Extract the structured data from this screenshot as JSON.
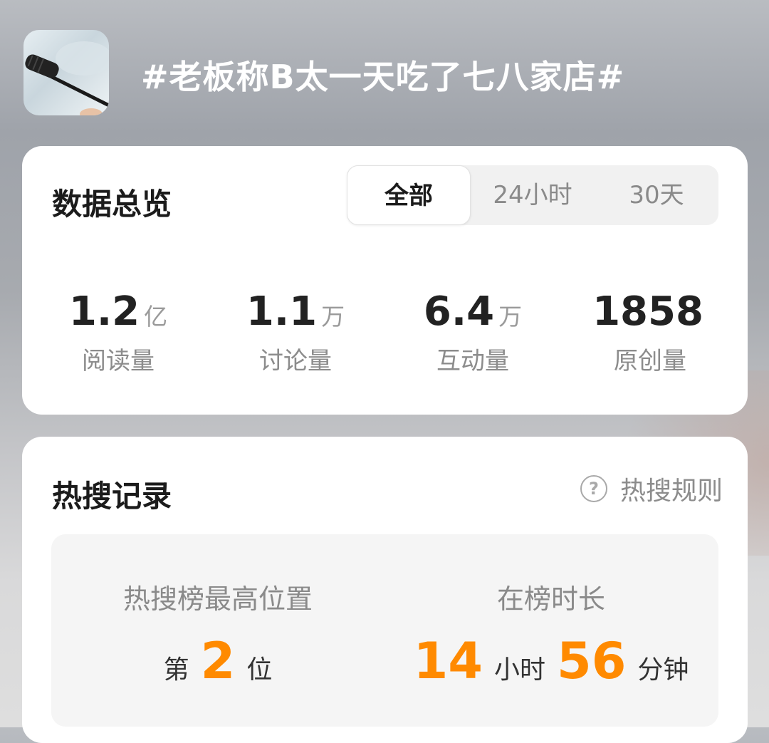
{
  "topic": {
    "title": "#老板称B太一天吃了七八家店#"
  },
  "overview": {
    "title": "数据总览",
    "tabs": [
      {
        "label": "全部",
        "active": true
      },
      {
        "label": "24小时",
        "active": false
      },
      {
        "label": "30天",
        "active": false
      }
    ],
    "stats": [
      {
        "value": "1.2",
        "unit": "亿",
        "label": "阅读量"
      },
      {
        "value": "1.1",
        "unit": "万",
        "label": "讨论量"
      },
      {
        "value": "6.4",
        "unit": "万",
        "label": "互动量"
      },
      {
        "value": "1858",
        "unit": "",
        "label": "原创量"
      }
    ]
  },
  "hot": {
    "title": "热搜记录",
    "rules_label": "热搜规则",
    "rules_icon": "question-circle-icon",
    "peak": {
      "label": "热搜榜最高位置",
      "prefix": "第",
      "rank": "2",
      "suffix": "位"
    },
    "duration": {
      "label": "在榜时长",
      "hours": "14",
      "hours_unit": "小时",
      "minutes": "56",
      "minutes_unit": "分钟"
    }
  },
  "colors": {
    "accent": "#ff8a00",
    "card_bg": "#ffffff",
    "title_text": "#ffffff"
  }
}
